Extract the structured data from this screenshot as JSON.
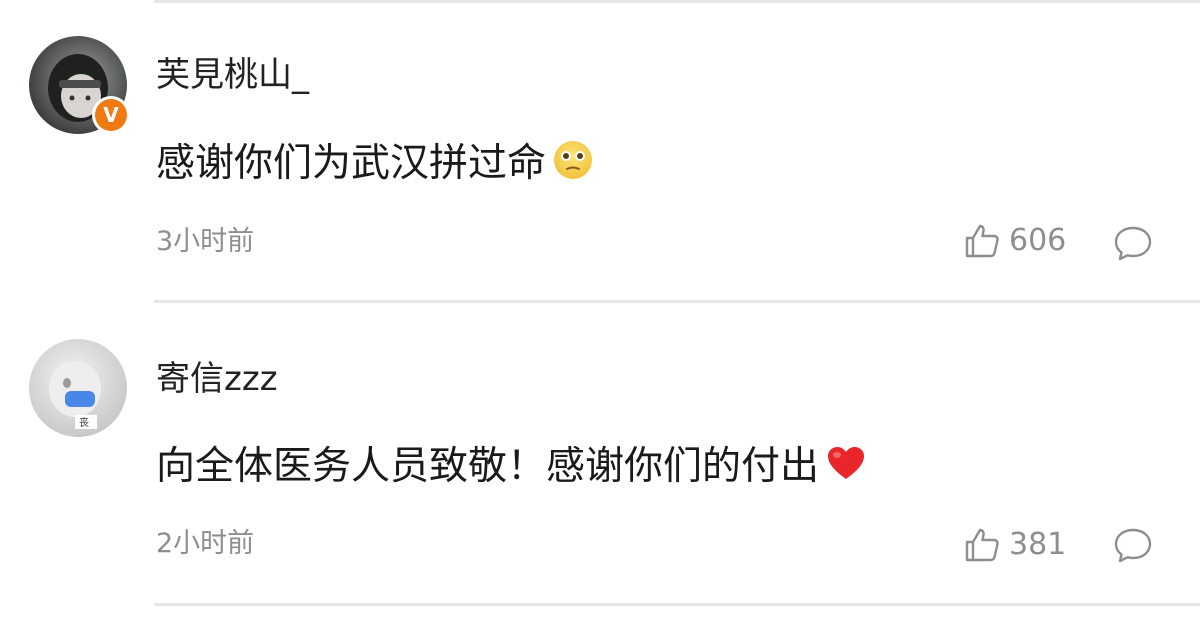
{
  "comments": [
    {
      "username": "芙見桃山_",
      "content": "感谢你们为武汉拼过命",
      "emoji": "pleading-face-emoji",
      "time": "3小时前",
      "likes": "606",
      "verified_badge": "V"
    },
    {
      "username": "寄信zzz",
      "content": "向全体医务人员致敬！感谢你们的付出",
      "emoji": "red-heart-emoji",
      "time": "2小时前",
      "likes": "381"
    }
  ],
  "colors": {
    "text": "#1a1a1a",
    "meta": "#8e8e8e",
    "divider": "#e6e6e6",
    "badge": "#f07a12",
    "heart": "#e8262b"
  }
}
